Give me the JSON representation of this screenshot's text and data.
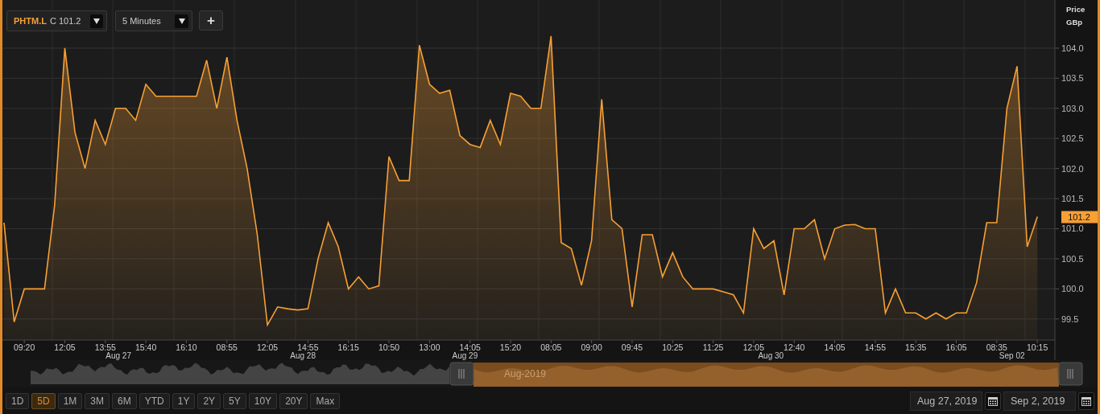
{
  "instrument": {
    "symbol": "PHTM.L",
    "field": "C",
    "value": "101.2"
  },
  "interval": {
    "value": "5 Minutes"
  },
  "add_button": {
    "label": "+"
  },
  "axis_title": {
    "line_1": "Price",
    "line_2": "GBp"
  },
  "last_price": "101.2",
  "chart": {
    "chart_data": {
      "type": "area",
      "categories": [
        null,
        null,
        "09:20",
        null,
        null,
        null,
        "12:05",
        null,
        null,
        null,
        "13:55",
        null,
        null,
        null,
        "15:40",
        null,
        null,
        null,
        "16:10",
        null,
        null,
        null,
        "08:55",
        null,
        null,
        null,
        "12:05",
        null,
        null,
        null,
        "14:55",
        null,
        null,
        null,
        "16:15",
        null,
        null,
        null,
        "10:50",
        null,
        null,
        null,
        "13:00",
        null,
        null,
        null,
        "14:05",
        null,
        null,
        null,
        "15:20",
        null,
        null,
        null,
        "08:05",
        null,
        null,
        null,
        "09:00",
        null,
        null,
        null,
        "09:45",
        null,
        null,
        null,
        "10:25",
        null,
        null,
        null,
        "11:25",
        null,
        null,
        null,
        "12:05",
        null,
        null,
        null,
        "12:40",
        null,
        null,
        null,
        "14:05",
        null,
        null,
        null,
        "14:55",
        null,
        null,
        null,
        "15:35",
        null,
        null,
        null,
        "16:05",
        null,
        null,
        null,
        "08:35",
        null,
        null,
        null,
        "10:15"
      ],
      "series": [
        {
          "color": "#f7a035",
          "values": [
            101.1,
            99.45,
            100.0,
            100.0,
            100.0,
            101.4,
            104.0,
            102.6,
            102.0,
            102.8,
            102.4,
            103.0,
            103.0,
            102.8,
            103.4,
            103.2,
            103.2,
            103.2,
            103.2,
            103.2,
            103.8,
            103.0,
            103.85,
            102.8,
            102.0,
            100.9,
            99.4,
            99.7,
            99.67,
            99.65,
            99.67,
            100.5,
            101.1,
            100.7,
            100.0,
            100.2,
            100.0,
            100.05,
            102.2,
            101.8,
            101.8,
            104.05,
            103.4,
            103.25,
            103.3,
            102.55,
            102.4,
            102.35,
            102.8,
            102.4,
            103.25,
            103.2,
            103.0,
            103.0,
            104.2,
            100.77,
            100.67,
            100.06,
            100.8,
            103.15,
            101.15,
            101.0,
            99.7,
            100.9,
            100.9,
            100.2,
            100.6,
            100.2,
            100.0,
            100.0,
            100.0,
            99.95,
            99.9,
            99.6,
            101.0,
            100.67,
            100.8,
            99.9,
            101.0,
            101.0,
            101.15,
            100.5,
            101.0,
            101.06,
            101.07,
            101.0,
            101.0,
            99.6,
            100.0,
            99.6,
            99.6,
            99.5,
            99.6,
            99.5,
            99.6,
            99.6,
            100.1,
            101.1,
            101.1,
            103.0,
            103.7,
            100.7,
            101.2
          ]
        }
      ],
      "ylim": [
        99.15,
        104.8
      ],
      "grid": true,
      "yticks": [
        {
          "value": 99.5,
          "label": "99.5"
        },
        {
          "value": 100,
          "label": "100.0"
        },
        {
          "value": 100.5,
          "label": "100.5"
        },
        {
          "value": 101,
          "label": "101.0"
        },
        {
          "value": 101.5,
          "label": "101.5"
        },
        {
          "value": 102,
          "label": "102.0"
        },
        {
          "value": 102.5,
          "label": "102.5"
        },
        {
          "value": 103,
          "label": "103.0"
        },
        {
          "value": 103.5,
          "label": "103.5"
        },
        {
          "value": 104,
          "label": "104.0"
        }
      ],
      "ylabel": null
    },
    "date_labels": [
      "Aug 27",
      "Aug 28",
      "Aug 29",
      "Aug 30",
      "Sep 02"
    ]
  },
  "navigator": {
    "label": "Aug-2019"
  },
  "ranges": [
    {
      "label": "1D",
      "selected": false
    },
    {
      "label": "5D",
      "selected": true
    },
    {
      "label": "1M",
      "selected": false
    },
    {
      "label": "3M",
      "selected": false
    },
    {
      "label": "6M",
      "selected": false
    },
    {
      "label": "YTD",
      "selected": false
    },
    {
      "label": "1Y",
      "selected": false
    },
    {
      "label": "2Y",
      "selected": false
    },
    {
      "label": "5Y",
      "selected": false
    },
    {
      "label": "10Y",
      "selected": false
    },
    {
      "label": "20Y",
      "selected": false
    },
    {
      "label": "Max",
      "selected": false
    }
  ],
  "date_from": "Aug 27, 2019",
  "date_to": "Sep 2, 2019"
}
